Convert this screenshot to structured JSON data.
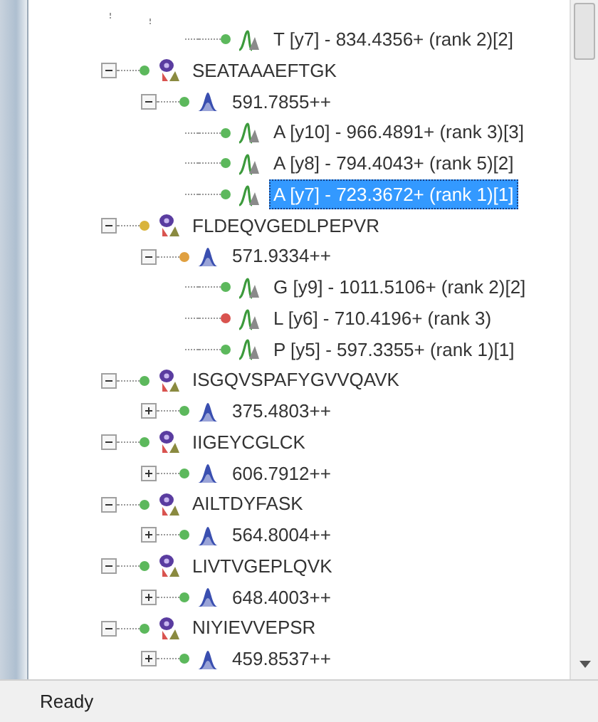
{
  "tree": [
    {
      "kind": "peptide",
      "children": [
        {
          "kind": "precursor",
          "children": [
            {
              "kind": "transition",
              "label": "T [y7] - 834.4356+ (rank 2)[2]",
              "color": "#5cb85c",
              "selected": false
            }
          ]
        }
      ]
    },
    {
      "kind": "peptide",
      "label": "SEATAAAEFTGK",
      "color": "#5cb85c",
      "expanded": true,
      "children": [
        {
          "kind": "precursor",
          "label": "591.7855++",
          "color": "#5cb85c",
          "expanded": true,
          "children": [
            {
              "kind": "transition",
              "label": "A [y10] - 966.4891+ (rank 3)[3]",
              "color": "#5cb85c",
              "selected": false
            },
            {
              "kind": "transition",
              "label": "A [y8] - 794.4043+ (rank 5)[2]",
              "color": "#5cb85c",
              "selected": false
            },
            {
              "kind": "transition",
              "label": "A [y7] - 723.3672+ (rank 1)[1]",
              "color": "#5cb85c",
              "selected": true
            }
          ]
        }
      ]
    },
    {
      "kind": "peptide",
      "label": "FLDEQVGEDLPEPVR",
      "color": "#d9b43c",
      "expanded": true,
      "children": [
        {
          "kind": "precursor",
          "label": "571.9334++",
          "color": "#e0a040",
          "expanded": true,
          "children": [
            {
              "kind": "transition",
              "label": "G [y9] - 1011.5106+ (rank 2)[2]",
              "color": "#5cb85c",
              "selected": false
            },
            {
              "kind": "transition",
              "label": "L [y6] - 710.4196+ (rank 3)",
              "color": "#d9534f",
              "selected": false
            },
            {
              "kind": "transition",
              "label": "P [y5] - 597.3355+ (rank 1)[1]",
              "color": "#5cb85c",
              "selected": false
            }
          ]
        }
      ]
    },
    {
      "kind": "peptide",
      "label": "ISGQVSPAFYGVVQAVK",
      "color": "#5cb85c",
      "expanded": true,
      "children": [
        {
          "kind": "precursor",
          "label": "375.4803++",
          "color": "#5cb85c",
          "expanded": false
        }
      ]
    },
    {
      "kind": "peptide",
      "label": "IIGEYCGLCK",
      "color": "#5cb85c",
      "expanded": true,
      "children": [
        {
          "kind": "precursor",
          "label": "606.7912++",
          "color": "#5cb85c",
          "expanded": false
        }
      ]
    },
    {
      "kind": "peptide",
      "label": "AILTDYFASK",
      "color": "#5cb85c",
      "expanded": true,
      "children": [
        {
          "kind": "precursor",
          "label": "564.8004++",
          "color": "#5cb85c",
          "expanded": false
        }
      ]
    },
    {
      "kind": "peptide",
      "label": "LIVTVGEPLQVK",
      "color": "#5cb85c",
      "expanded": true,
      "children": [
        {
          "kind": "precursor",
          "label": "648.4003++",
          "color": "#5cb85c",
          "expanded": false
        }
      ]
    },
    {
      "kind": "peptide",
      "label": "NIYIEVVEPSR",
      "color": "#5cb85c",
      "expanded": true,
      "children": [
        {
          "kind": "precursor",
          "label": "459.8537++",
          "color": "#5cb85c",
          "expanded": false
        }
      ]
    }
  ],
  "status_bar": {
    "text": "Ready"
  }
}
